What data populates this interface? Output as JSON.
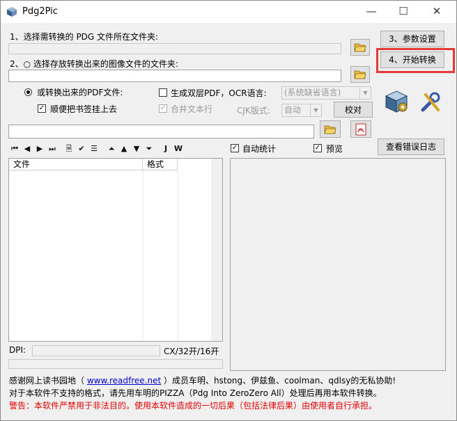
{
  "window": {
    "title": "Pdg2Pic",
    "controls": [
      "—",
      "☐",
      "✕"
    ]
  },
  "step1": {
    "label": "1、选择需转换的 PDG 文件所在文件夹:",
    "value": ""
  },
  "step2": {
    "label": "2、○ 选择存放转换出来的图像文件的文件夹:",
    "value": ""
  },
  "buttons": {
    "params": "3、参数设置",
    "start": "4、开始转换",
    "proofread": "校对",
    "error_log": "查看错误日志"
  },
  "options": {
    "pdf_radio": "或转换出来的PDF文件:",
    "bookmark_check": "顺便把书签挂上去",
    "dual_layer": "生成双层PDF，OCR语言:",
    "ocr_lang": "(系统缺省语言)",
    "merge_text": "合并文本行",
    "cjk_label": "CJK版式:",
    "cjk_value": "自动",
    "auto_stat": "自动统计",
    "preview": "预览"
  },
  "file_list": {
    "columns": [
      "文件",
      "格式"
    ]
  },
  "dpi": {
    "label": "DPI:",
    "info": "CX/32开/16开"
  },
  "footer": {
    "line1_pre": "感谢网上读书园地（ ",
    "link": "www.readfree.net",
    "line1_post": " ）成员车明、hstong、伊兹鱼、coolman、qdlsy的无私协助!",
    "line2": "对于本软件不支持的格式，请先用车明的PIZZA（Pdg Into ZeroZero All）处理后再用本软件转换。",
    "warning": "警告：本软件严禁用于非法目的。使用本软件造成的一切后果（包括法律后果）由使用者自行承担。"
  },
  "colors": {
    "highlight": "#e53935",
    "warning": "#e00000",
    "link": "#0000cc"
  }
}
